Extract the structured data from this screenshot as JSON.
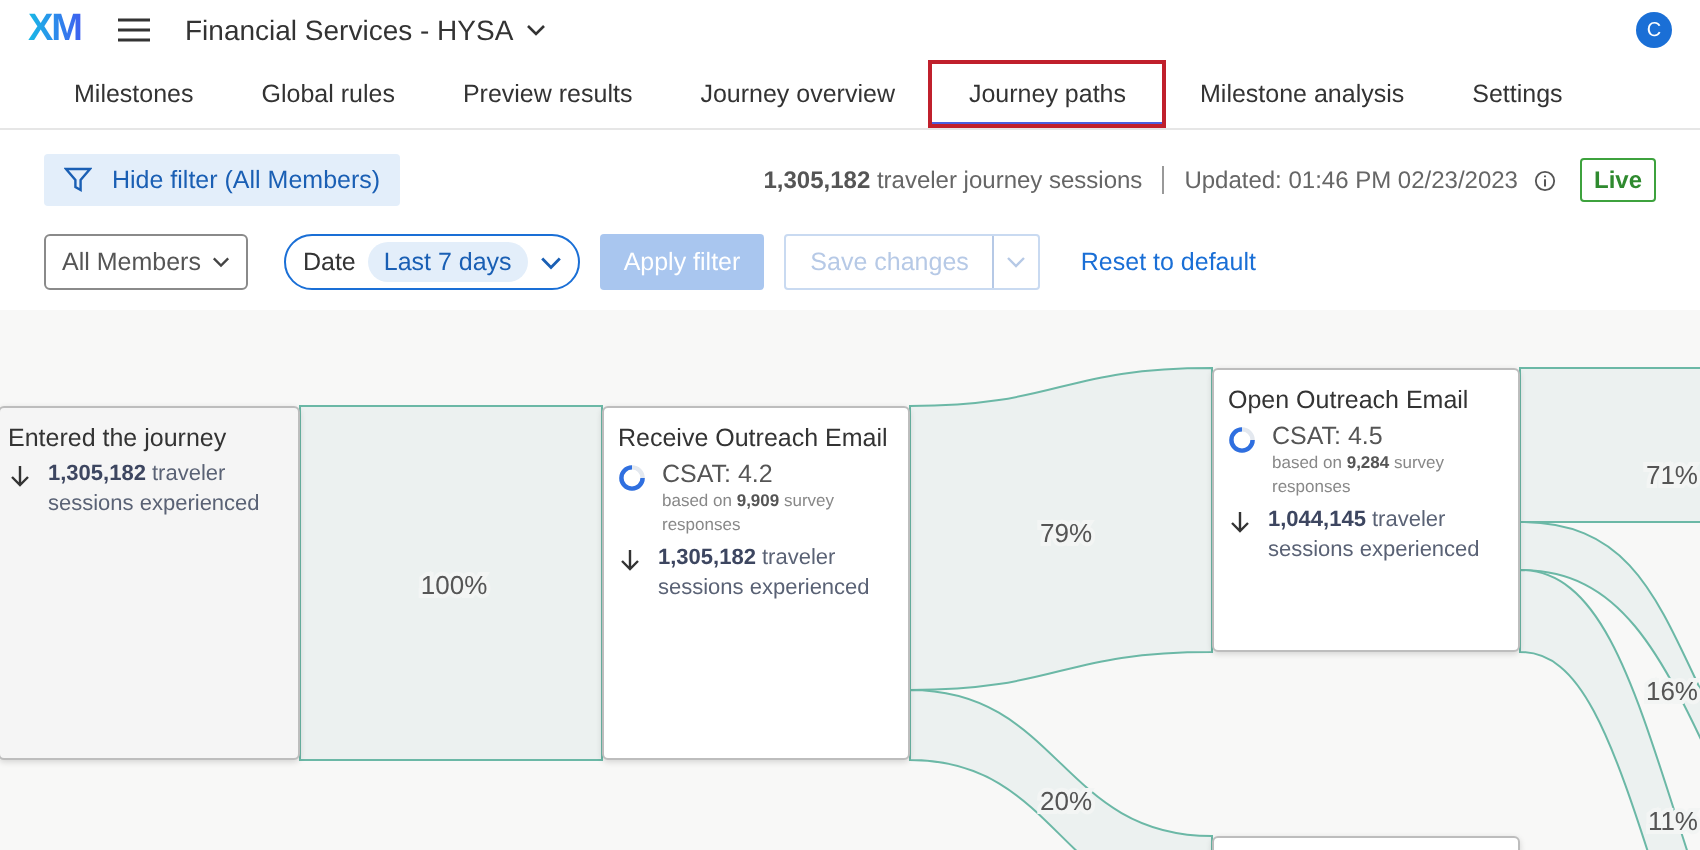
{
  "header": {
    "logo": "XM",
    "project": "Financial Services - HYSA",
    "avatar": "C"
  },
  "tabs": [
    {
      "label": "Milestones",
      "selected": false,
      "highlighted": false
    },
    {
      "label": "Global rules",
      "selected": false,
      "highlighted": false
    },
    {
      "label": "Preview results",
      "selected": false,
      "highlighted": false
    },
    {
      "label": "Journey overview",
      "selected": false,
      "highlighted": false
    },
    {
      "label": "Journey paths",
      "selected": true,
      "highlighted": true
    },
    {
      "label": "Milestone analysis",
      "selected": false,
      "highlighted": false
    },
    {
      "label": "Settings",
      "selected": false,
      "highlighted": false
    }
  ],
  "toolbar": {
    "filter_button": "Hide filter (All Members)",
    "sessions": "**1,305,182** traveler journey sessions",
    "updated": "Updated: 01:46 PM 02/23/2023",
    "status": "Live"
  },
  "filters": {
    "members": "All Members",
    "date_label": "Date",
    "date_value": "Last 7 days",
    "apply": "Apply filter",
    "apply_disabled": true,
    "save": "Save changes",
    "save_disabled": true,
    "reset": "Reset to default"
  },
  "nodes": [
    {
      "kind": "start",
      "title": "Entered the journey",
      "sessions": "**1,305,182** traveler sessions experienced"
    },
    {
      "kind": "milestone",
      "title": "Receive Outreach Email",
      "csat": "CSAT: 4.2",
      "survey": "based on **9,909** survey responses",
      "sessions": "**1,305,182** traveler sessions experienced"
    },
    {
      "kind": "milestone",
      "title": "Open Outreach Email",
      "csat": "CSAT: 4.5",
      "survey": "based on **9,284** survey responses",
      "sessions": "**1,044,145** traveler sessions experienced"
    },
    {
      "kind": "milestone"
    }
  ],
  "flows": [
    {
      "label": "100%"
    },
    {
      "label": "79%"
    },
    {
      "label": "20%"
    },
    {
      "label": "71%"
    },
    {
      "label": "16%"
    },
    {
      "label": "11%"
    }
  ]
}
